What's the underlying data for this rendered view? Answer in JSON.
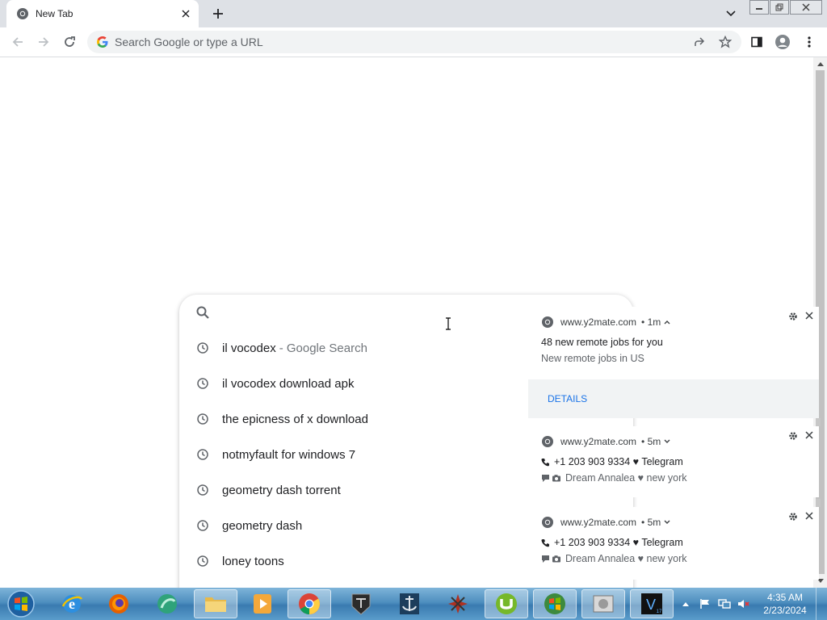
{
  "tab": {
    "title": "New Tab",
    "favicon": "chrome-icon"
  },
  "toolbar": {
    "omnibox_placeholder": "Search Google or type a URL"
  },
  "ntp": {
    "search_placeholder": "",
    "suggestions": [
      {
        "text": "il vocodex",
        "suffix": "- Google Search"
      },
      {
        "text": "il vocodex download apk",
        "suffix": ""
      },
      {
        "text": "the epicness of x download",
        "suffix": ""
      },
      {
        "text": "notmyfault for windows 7",
        "suffix": ""
      },
      {
        "text": "geometry dash torrent",
        "suffix": ""
      },
      {
        "text": "geometry dash",
        "suffix": ""
      },
      {
        "text": "loney toons",
        "suffix": ""
      }
    ]
  },
  "notifications": [
    {
      "origin": "www.y2mate.com",
      "time": "• 1m",
      "line1": "48 new remote jobs for you",
      "line2": "New remote jobs in US",
      "action": "DETAILS"
    },
    {
      "origin": "www.y2mate.com",
      "time": "• 5m",
      "line1": "+1 203 903 9334 ♥ Telegram",
      "line2": "Dream Annalea ♥ new york"
    },
    {
      "origin": "www.y2mate.com",
      "time": "• 5m",
      "line1": "+1 203 903 9334 ♥ Telegram",
      "line2": "Dream Annalea ♥ new york"
    }
  ],
  "taskbar": {
    "clock_time": "4:35 AM",
    "clock_date": "2/23/2024",
    "apps": [
      "internet-explorer-icon",
      "firefox-icon",
      "app-icon",
      "file-explorer-icon",
      "media-player-icon",
      "chrome-icon",
      "world-of-tanks-icon",
      "world-of-warships-icon",
      "game-icon",
      "utorrent-icon",
      "windows-icon",
      "device-icon",
      "vegas-icon"
    ]
  },
  "colors": {
    "accent": "#1a73e8",
    "tab_strip": "#dee1e6",
    "omnibox": "#f1f3f4"
  }
}
